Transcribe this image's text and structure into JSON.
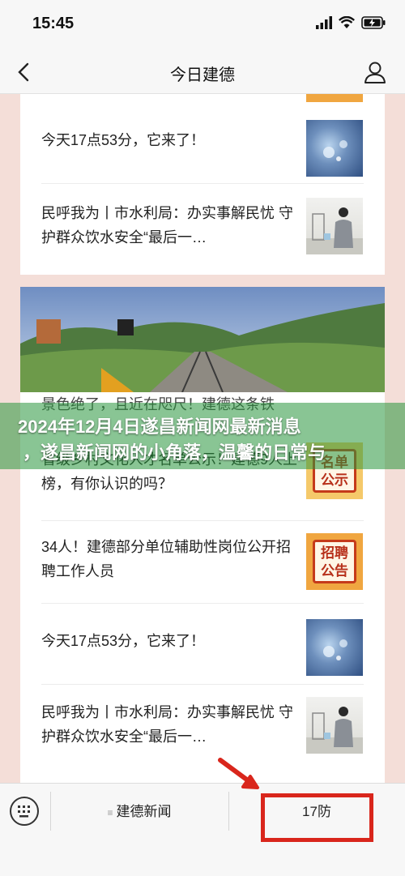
{
  "status_bar": {
    "time": "15:45"
  },
  "nav": {
    "title": "今日建德"
  },
  "feed": {
    "items_top": [
      {
        "title": "今天17点53分，它来了！",
        "thumb": "water-drops-image"
      },
      {
        "title": "民呼我为丨市水利局：办实事解民忧 守护群众饮水安全“最后一…",
        "thumb": "lab-technician-image"
      }
    ],
    "photo_caption": "景色绝了，且近在咫尺！建德这条铁",
    "items_bottom": [
      {
        "title": "省级乡村文化人才名单公示！建德9人上榜，有你认识的吗？",
        "thumb": "notice-image",
        "thumb_text": "名单公示"
      },
      {
        "title": "34人！建德部分单位辅助性岗位公开招聘工作人员",
        "thumb": "recruitment-image",
        "thumb_text": "招聘公告"
      },
      {
        "title": "今天17点53分，它来了！",
        "thumb": "water-drops-image"
      },
      {
        "title": "民呼我为丨市水利局：办实事解民忧 守护群众饮水安全“最后一…",
        "thumb": "lab-technician-image"
      }
    ]
  },
  "banner": {
    "line1": "2024年12月4日遂昌新闻网最新消息",
    "line2": "，遂昌新闻网的小角落，温馨的日常与"
  },
  "bottom_menu": {
    "item1": "建德新闻",
    "item2": "17防"
  },
  "colors": {
    "highlight": "#d9261c",
    "banner": "#2e9a46"
  }
}
